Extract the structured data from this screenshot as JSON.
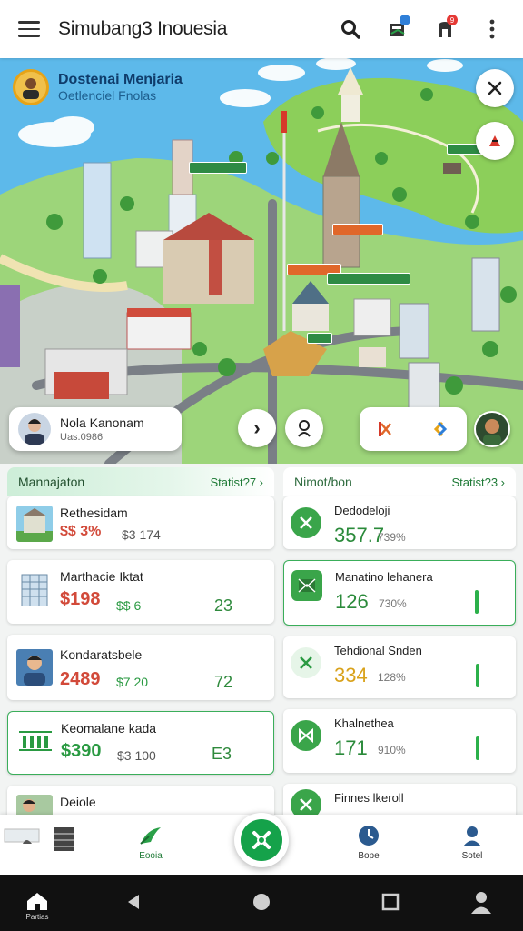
{
  "app": {
    "title": "Simubang3 Inouesia"
  },
  "topbar": {
    "icons": [
      "menu-icon",
      "search-icon",
      "inbox-icon",
      "notification-icon",
      "more-icon"
    ],
    "badges": {
      "inbox": "",
      "notification": "9"
    },
    "colors": {
      "inbox_badge": "#2f7fd8",
      "notification_badge": "#e53935"
    }
  },
  "map": {
    "title": "Dostenai Menjaria",
    "subtitle": "Oetlenciel Fnolas",
    "labels": [
      "",
      "",
      "",
      "",
      "",
      ""
    ],
    "profile": {
      "name": "Nola Kanonam",
      "sub": "Uas.0986"
    },
    "controls": {
      "next": "›",
      "locate": "location-pin-icon"
    }
  },
  "left_panel": {
    "header": "Mannajaton",
    "link": "Statist?7 ›",
    "cards": [
      {
        "title": "Rethesidam",
        "value": "$$ 3%",
        "secondary": "$3 174",
        "number": "",
        "value_color": "#d24a3a",
        "highlight": false,
        "thumb": "house"
      },
      {
        "title": "Marthacie Iktat",
        "value": "$198",
        "secondary": "$$ 6",
        "number": "23",
        "value_color": "#d24a3a",
        "highlight": false,
        "thumb": "building"
      },
      {
        "title": "Kondaratsbele",
        "value": "2489",
        "secondary": "$7 20",
        "number": "72",
        "value_color": "#d24a3a",
        "highlight": false,
        "thumb": "person"
      },
      {
        "title": "Keomalane kada",
        "value": "$390",
        "secondary": "$3 100",
        "number": "E3",
        "value_color": "#2a9a42",
        "highlight": true,
        "thumb": "chart"
      },
      {
        "title": "Deiole",
        "value": "",
        "secondary": "",
        "number": "",
        "value_color": "#2a9a42",
        "highlight": false,
        "thumb": "person2"
      }
    ]
  },
  "right_panel": {
    "header": "Nimot/bon",
    "link": "Statist?3 ›",
    "cards": [
      {
        "title": "Dedodeloji",
        "value": "357.7",
        "pct": "739%",
        "highlight": false,
        "icon": "leaf-x-icon",
        "bar": false
      },
      {
        "title": "Manatino lehanera",
        "value": "126",
        "pct": "730%",
        "highlight": true,
        "icon": "envelope-icon",
        "bar": true
      },
      {
        "title": "Tehdional Snden",
        "value": "334",
        "pct": "128%",
        "highlight": false,
        "icon": "x-mark-icon",
        "bar": true
      },
      {
        "title": "Khalnethea",
        "value": "171",
        "pct": "910%",
        "highlight": false,
        "icon": "bowtie-icon",
        "bar": true
      },
      {
        "title": "Finnes lkeroll",
        "value": "",
        "pct": "",
        "highlight": false,
        "icon": "leaf-x-icon",
        "bar": false
      }
    ]
  },
  "bottom_nav": {
    "items": [
      {
        "label": "",
        "icon": "layers-icon"
      },
      {
        "label": "Eooia",
        "icon": "plane-icon"
      },
      {
        "label": "Bope",
        "icon": "clock-icon"
      },
      {
        "label": "Sotel",
        "icon": "profile-icon"
      }
    ],
    "fab_icon": "asterisk-icon"
  },
  "system_bar": {
    "home_label": "Partias",
    "icons": [
      "home-icon",
      "back-icon",
      "circle-icon",
      "square-icon",
      "person-icon"
    ]
  }
}
